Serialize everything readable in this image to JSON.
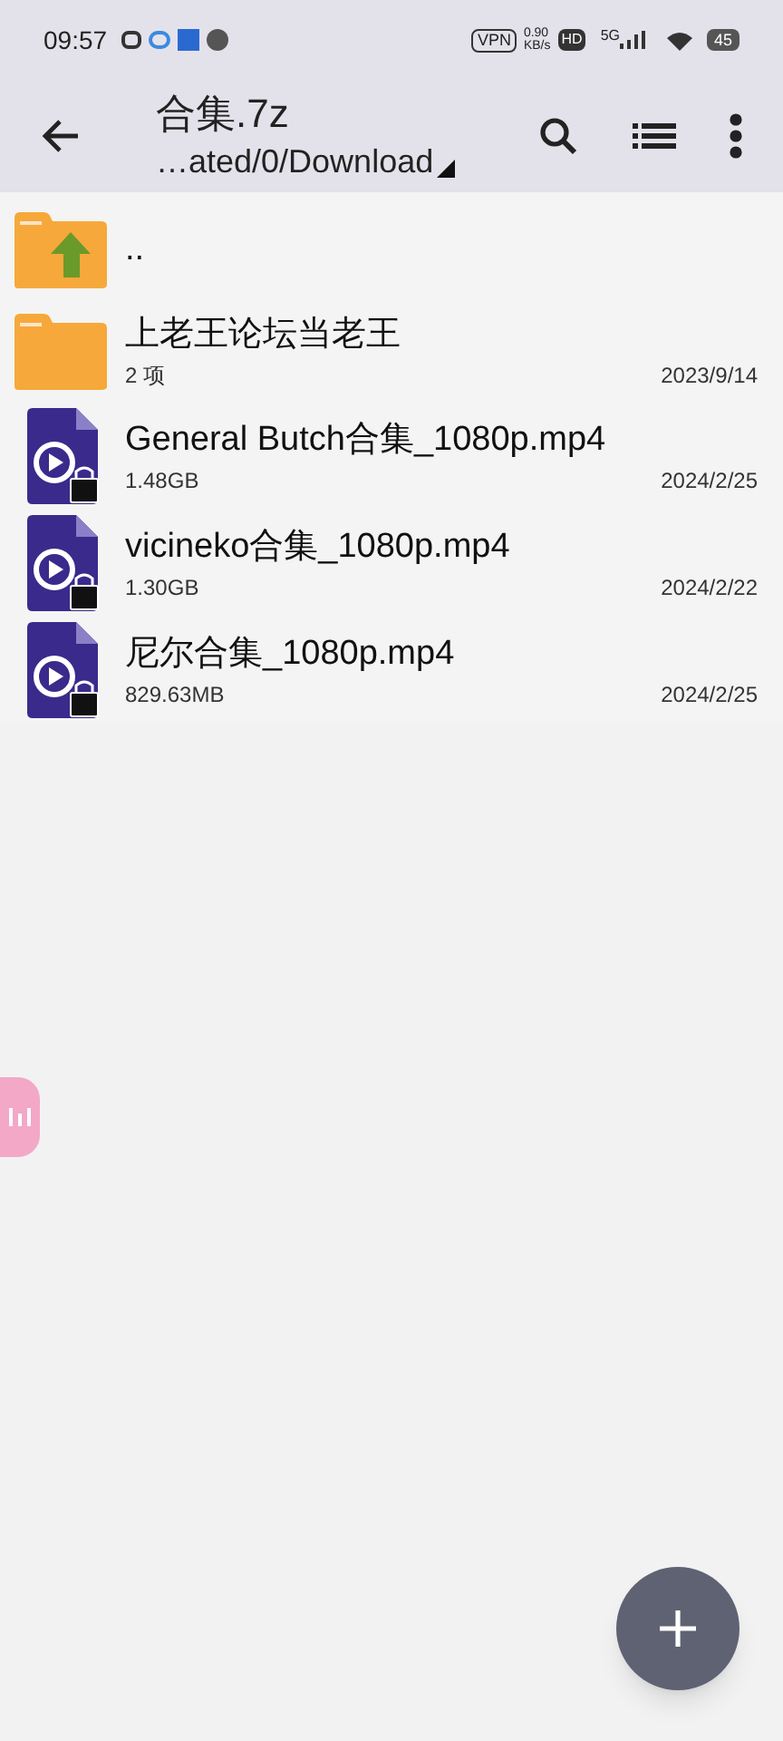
{
  "status_bar": {
    "time": "09:57",
    "vpn": "VPN",
    "speed": "0.90",
    "speed_unit": "KB/s",
    "hd": "HD",
    "network": "5G",
    "battery": "45"
  },
  "toolbar": {
    "title": "合集.7z",
    "path": "…ated/0/Download"
  },
  "files": [
    {
      "kind": "parent",
      "name": ".."
    },
    {
      "kind": "folder",
      "name": "上老王论坛当老王",
      "info": "2 项",
      "date": "2023/9/14"
    },
    {
      "kind": "video",
      "name": "General Butch合集_1080p.mp4",
      "info": "1.48GB",
      "date": "2024/2/25",
      "encrypted": true
    },
    {
      "kind": "video",
      "name": "vicineko合集_1080p.mp4",
      "info": "1.30GB",
      "date": "2024/2/22",
      "encrypted": true
    },
    {
      "kind": "video",
      "name": "尼尔合集_1080p.mp4",
      "info": "829.63MB",
      "date": "2024/2/25",
      "encrypted": true
    }
  ]
}
